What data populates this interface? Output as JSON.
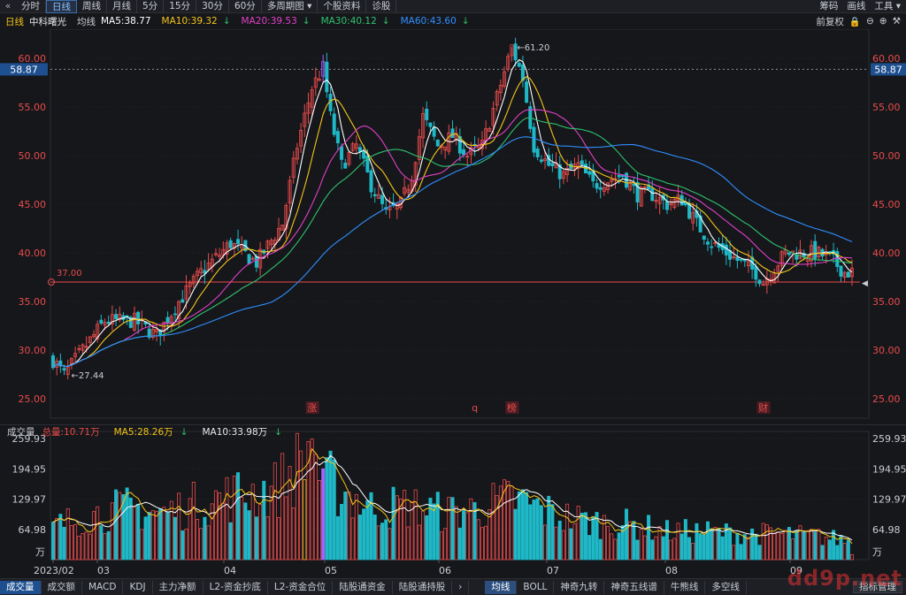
{
  "colors": {
    "up": "#e84b4b",
    "down": "#1fb8c7",
    "ma5": "#ffffff",
    "ma10": "#f5c518",
    "ma20": "#e040c8",
    "ma30": "#2ec26e",
    "ma60": "#2f8fff",
    "grid": "#2a2c33",
    "axis_text": "#e84b4b",
    "highlight": "#a562ff",
    "vol_highlight": "#f5c518"
  },
  "topbar": {
    "back_icon": "double-chevron-left-icon",
    "tabs": [
      "分时",
      "日线",
      "周线",
      "月线",
      "5分",
      "15分",
      "30分",
      "60分",
      "多周期图",
      "个股资料",
      "诊股"
    ],
    "active_tab": 1,
    "right": [
      "筹码",
      "画线",
      "工具"
    ]
  },
  "header": {
    "period": "日线",
    "stock_name": "中科曙光",
    "avg_label": "均线",
    "ma5": "MA5:38.77",
    "ma10": "MA10:39.32",
    "ma20": "MA20:39.53",
    "ma30": "MA30:40.12",
    "ma60": "MA60:43.60",
    "right_label": "前复权"
  },
  "price_axis": {
    "labels": [
      "60.00",
      "55.00",
      "50.00",
      "45.00",
      "40.00",
      "35.00",
      "30.00",
      "25.00"
    ],
    "current": "58.87",
    "support": "37.00",
    "high_mark": "61.20",
    "low_mark": "27.44"
  },
  "events": [
    "涨",
    "q",
    "榜",
    "财"
  ],
  "volume": {
    "title": "成交量",
    "total": "总量:10.71万",
    "ma5": "MA5:28.26万",
    "ma10": "MA10:33.98万",
    "labels": [
      "259.93",
      "194.95",
      "129.97",
      "64.98"
    ],
    "unit": "万"
  },
  "time_axis": [
    "2023/02",
    "03",
    "04",
    "05",
    "06",
    "07",
    "08",
    "09"
  ],
  "bottom_tabs": [
    "成交量",
    "成交额",
    "MACD",
    "KDJ",
    "主力净额",
    "L2-资金抄底",
    "L2-资金合位",
    "陆股通资金",
    "陆股通持股"
  ],
  "bottom_tabs2": [
    "均线",
    "BOLL",
    "神奇九转",
    "神奇五线谱",
    "牛熊线",
    "多空线"
  ],
  "bottom_right": "指标管理",
  "watermark": "dd9p.net",
  "chart_data": {
    "type": "candlestick",
    "ylim": [
      23,
      63
    ],
    "vol_ylim": [
      0,
      260
    ],
    "keypoints": [
      [
        0,
        29
      ],
      [
        3,
        27.44
      ],
      [
        8,
        30
      ],
      [
        14,
        33
      ],
      [
        22,
        33
      ],
      [
        28,
        31.5
      ],
      [
        34,
        35
      ],
      [
        40,
        38
      ],
      [
        48,
        41
      ],
      [
        55,
        39
      ],
      [
        62,
        43
      ],
      [
        66,
        51
      ],
      [
        70,
        57
      ],
      [
        73,
        59
      ],
      [
        75,
        54
      ],
      [
        78,
        49
      ],
      [
        82,
        51
      ],
      [
        86,
        47
      ],
      [
        90,
        44
      ],
      [
        94,
        45
      ],
      [
        97,
        48
      ],
      [
        100,
        54
      ],
      [
        104,
        51
      ],
      [
        108,
        52
      ],
      [
        112,
        50
      ],
      [
        116,
        51
      ],
      [
        120,
        56
      ],
      [
        124,
        61.2
      ],
      [
        127,
        58
      ],
      [
        130,
        51
      ],
      [
        134,
        49
      ],
      [
        138,
        48
      ],
      [
        142,
        49
      ],
      [
        146,
        47
      ],
      [
        150,
        47.5
      ],
      [
        154,
        48
      ],
      [
        158,
        46
      ],
      [
        162,
        46
      ],
      [
        166,
        45
      ],
      [
        170,
        45.5
      ],
      [
        174,
        43
      ],
      [
        178,
        41
      ],
      [
        182,
        40
      ],
      [
        186,
        39
      ],
      [
        190,
        38
      ],
      [
        192,
        37
      ],
      [
        195,
        38.5
      ],
      [
        198,
        40
      ],
      [
        202,
        40
      ],
      [
        206,
        40
      ],
      [
        210,
        39.5
      ],
      [
        214,
        38
      ],
      [
        216,
        38
      ]
    ],
    "vol_keypoints": [
      [
        0,
        70
      ],
      [
        10,
        95
      ],
      [
        20,
        110
      ],
      [
        30,
        100
      ],
      [
        40,
        120
      ],
      [
        50,
        140
      ],
      [
        60,
        150
      ],
      [
        66,
        200
      ],
      [
        70,
        240
      ],
      [
        74,
        170
      ],
      [
        78,
        150
      ],
      [
        86,
        110
      ],
      [
        96,
        115
      ],
      [
        106,
        100
      ],
      [
        116,
        110
      ],
      [
        124,
        130
      ],
      [
        128,
        120
      ],
      [
        136,
        95
      ],
      [
        146,
        80
      ],
      [
        156,
        75
      ],
      [
        166,
        60
      ],
      [
        176,
        60
      ],
      [
        186,
        55
      ],
      [
        196,
        55
      ],
      [
        206,
        50
      ],
      [
        216,
        40
      ]
    ]
  }
}
